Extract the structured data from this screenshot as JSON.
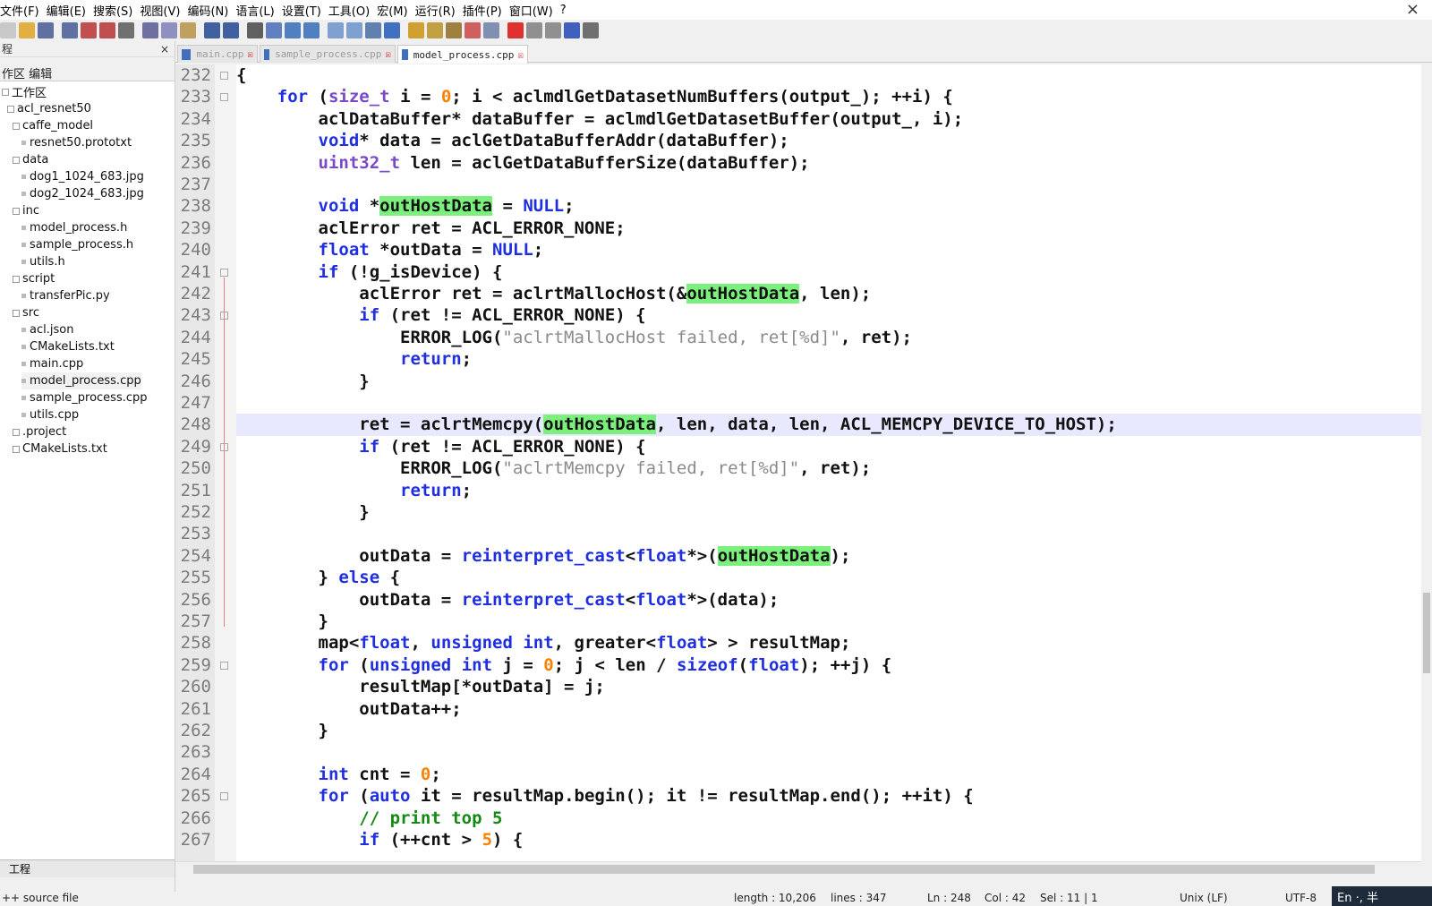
{
  "menubar": {
    "items": [
      "文件(F)",
      "编辑(E)",
      "搜索(S)",
      "视图(V)",
      "编码(N)",
      "语言(L)",
      "设置(T)",
      "工具(O)",
      "宏(M)",
      "运行(R)",
      "插件(P)",
      "窗口(W)",
      "?"
    ],
    "close_glyph": "×"
  },
  "left_panel": {
    "header_label": "程",
    "header_close": "×",
    "title": "作区 编辑",
    "tree": [
      {
        "label": "工作区",
        "indent": 0
      },
      {
        "label": "acl_resnet50",
        "indent": 1
      },
      {
        "label": "caffe_model",
        "indent": 2
      },
      {
        "label": "resnet50.prototxt",
        "indent": 3
      },
      {
        "label": "data",
        "indent": 2
      },
      {
        "label": "dog1_1024_683.jpg",
        "indent": 3
      },
      {
        "label": "dog2_1024_683.jpg",
        "indent": 3
      },
      {
        "label": "inc",
        "indent": 2
      },
      {
        "label": "model_process.h",
        "indent": 3
      },
      {
        "label": "sample_process.h",
        "indent": 3
      },
      {
        "label": "utils.h",
        "indent": 3
      },
      {
        "label": "script",
        "indent": 2
      },
      {
        "label": "transferPic.py",
        "indent": 3
      },
      {
        "label": "src",
        "indent": 2
      },
      {
        "label": "acl.json",
        "indent": 3
      },
      {
        "label": "CMakeLists.txt",
        "indent": 3
      },
      {
        "label": "main.cpp",
        "indent": 3
      },
      {
        "label": "model_process.cpp",
        "indent": 3
      },
      {
        "label": "sample_process.cpp",
        "indent": 3
      },
      {
        "label": "utils.cpp",
        "indent": 3
      },
      {
        "label": ".project",
        "indent": 2
      },
      {
        "label": "CMakeLists.txt",
        "indent": 2
      }
    ],
    "bottom_tab": "工程"
  },
  "tabs": [
    {
      "label": "main.cpp",
      "active": false
    },
    {
      "label": "sample_process.cpp",
      "active": false
    },
    {
      "label": "model_process.cpp",
      "active": true
    }
  ],
  "editor": {
    "first_line": 232,
    "current_line": 248,
    "lines": [
      "{",
      "    for (size_t i = 0; i < aclmdlGetDatasetNumBuffers(output_); ++i) {",
      "        aclDataBuffer* dataBuffer = aclmdlGetDatasetBuffer(output_, i);",
      "        void* data = aclGetDataBufferAddr(dataBuffer);",
      "        uint32_t len = aclGetDataBufferSize(dataBuffer);",
      "",
      "        void *outHostData = NULL;",
      "        aclError ret = ACL_ERROR_NONE;",
      "        float *outData = NULL;",
      "        if (!g_isDevice) {",
      "            aclError ret = aclrtMallocHost(&outHostData, len);",
      "            if (ret != ACL_ERROR_NONE) {",
      "                ERROR_LOG(\"aclrtMallocHost failed, ret[%d]\", ret);",
      "                return;",
      "            }",
      "",
      "            ret = aclrtMemcpy(outHostData, len, data, len, ACL_MEMCPY_DEVICE_TO_HOST);",
      "            if (ret != ACL_ERROR_NONE) {",
      "                ERROR_LOG(\"aclrtMemcpy failed, ret[%d]\", ret);",
      "                return;",
      "            }",
      "",
      "            outData = reinterpret_cast<float*>(outHostData);",
      "        } else {",
      "            outData = reinterpret_cast<float*>(data);",
      "        }",
      "        map<float, unsigned int, greater<float> > resultMap;",
      "        for (unsigned int j = 0; j < len / sizeof(float); ++j) {",
      "            resultMap[*outData] = j;",
      "            outData++;",
      "        }",
      "",
      "        int cnt = 0;",
      "        for (auto it = resultMap.begin(); it != resultMap.end(); ++it) {",
      "            // print top 5",
      "            if (++cnt > 5) {"
    ],
    "highlight_word": "outHostData"
  },
  "statusbar": {
    "file_type": "++ source file",
    "length": "length : 10,206",
    "lines": "lines : 347",
    "ln": "Ln : 248",
    "col": "Col : 42",
    "sel": "Sel : 11 | 1",
    "eol": "Unix (LF)",
    "encoding": "UTF-8",
    "ime": "En ·, 半"
  },
  "colors": {
    "keyword": "#1f2fe0",
    "type": "#7a49c7",
    "number": "#ff8000",
    "string": "#8a8a8a",
    "comment": "#148a14",
    "highlight": "#7cf07c",
    "current_line": "#e8e8ff"
  }
}
